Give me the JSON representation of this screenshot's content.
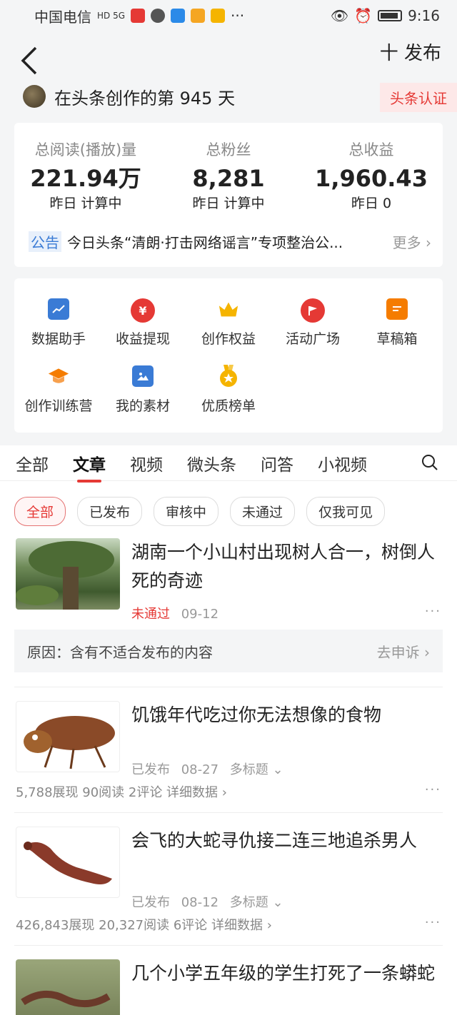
{
  "status_bar": {
    "carrier": "中国电信",
    "time": "9:16",
    "signal": "HD 5G",
    "more": "···"
  },
  "header": {
    "back_icon": "←",
    "publish_label": "十 发布"
  },
  "user": {
    "days_text": "在头条创作的第 945 天",
    "badge": "头条认证"
  },
  "stats": [
    {
      "label": "总阅读(播放)量",
      "value": "221.94万",
      "sub": "昨日 计算中"
    },
    {
      "label": "总粉丝",
      "value": "8,281",
      "sub": "昨日 计算中"
    },
    {
      "label": "总收益",
      "value": "1,960.43",
      "sub": "昨日 0"
    }
  ],
  "notice": {
    "tag": "公告",
    "text": "今日头条“清朗·打击网络谣言”专项整治公...",
    "more": "更多 ›"
  },
  "tools": [
    {
      "label": "数据助手",
      "icon": "chart-icon",
      "color": "#3a7bd5"
    },
    {
      "label": "收益提现",
      "icon": "yen-icon",
      "color": "#e53935"
    },
    {
      "label": "创作权益",
      "icon": "crown-icon",
      "color": "#f5b400"
    },
    {
      "label": "活动广场",
      "icon": "flag-icon",
      "color": "#e53935"
    },
    {
      "label": "草稿箱",
      "icon": "draft-icon",
      "color": "#f57c00"
    },
    {
      "label": "创作训练营",
      "icon": "grad-cap-icon",
      "color": "#f57c00"
    },
    {
      "label": "我的素材",
      "icon": "image-icon",
      "color": "#3a7bd5"
    },
    {
      "label": "优质榜单",
      "icon": "medal-icon",
      "color": "#f5b400"
    }
  ],
  "tabs": [
    "全部",
    "文章",
    "视频",
    "微头条",
    "问答",
    "小视频"
  ],
  "active_tab": "文章",
  "chips": [
    "全部",
    "已发布",
    "审核中",
    "未通过",
    "仅我可见"
  ],
  "articles": [
    {
      "title": "湖南一个小山村出现树人合一，树倒人死的奇迹",
      "status": "未通过",
      "date": "09-12",
      "reason": "原因：含有不适合发布的内容",
      "appeal": "去申诉 ›"
    },
    {
      "title": "饥饿年代吃过你无法想像的食物",
      "status": "已发布",
      "date": "08-27",
      "multi": "多标题 ⌄",
      "stats": "5,788展现  90阅读  2评论  详细数据 ›"
    },
    {
      "title": "会飞的大蛇寻仇接二连三地追杀男人",
      "status": "已发布",
      "date": "08-12",
      "multi": "多标题 ⌄",
      "stats": "426,843展现  20,327阅读  6评论  详细数据 ›"
    },
    {
      "title": "几个小学五年级的学生打死了一条蟒蛇"
    }
  ],
  "dots": "···"
}
